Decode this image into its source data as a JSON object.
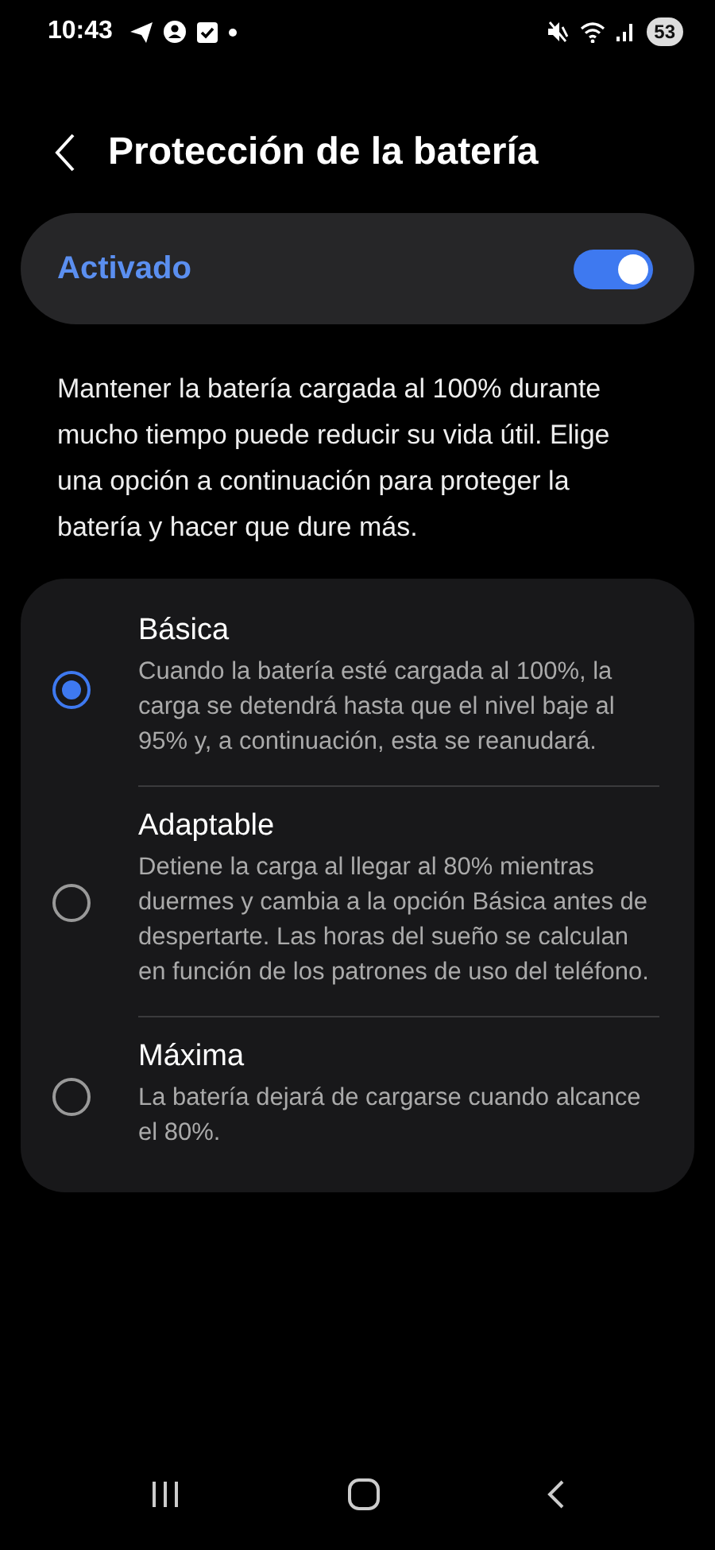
{
  "status_bar": {
    "time": "10:43",
    "battery": "53"
  },
  "header": {
    "title": "Protección de la batería"
  },
  "master_switch": {
    "label": "Activado",
    "on": true
  },
  "description": "Mantener la batería cargada al 100% durante mucho tiempo puede reducir su vida útil. Elige una opción a continuación para proteger la batería y hacer que dure más.",
  "options": [
    {
      "title": "Básica",
      "description": "Cuando la batería esté cargada al 100%, la carga se detendrá hasta que el nivel baje al 95% y, a continuación, esta se reanudará.",
      "selected": true
    },
    {
      "title": "Adaptable",
      "description": "Detiene la carga al llegar al 80% mientras duermes y cambia a la opción Básica antes de despertarte. Las horas del sueño se calculan en función de los patrones de uso del teléfono.",
      "selected": false
    },
    {
      "title": "Máxima",
      "description": "La batería dejará de cargarse cuando alcance el 80%.",
      "selected": false
    }
  ]
}
